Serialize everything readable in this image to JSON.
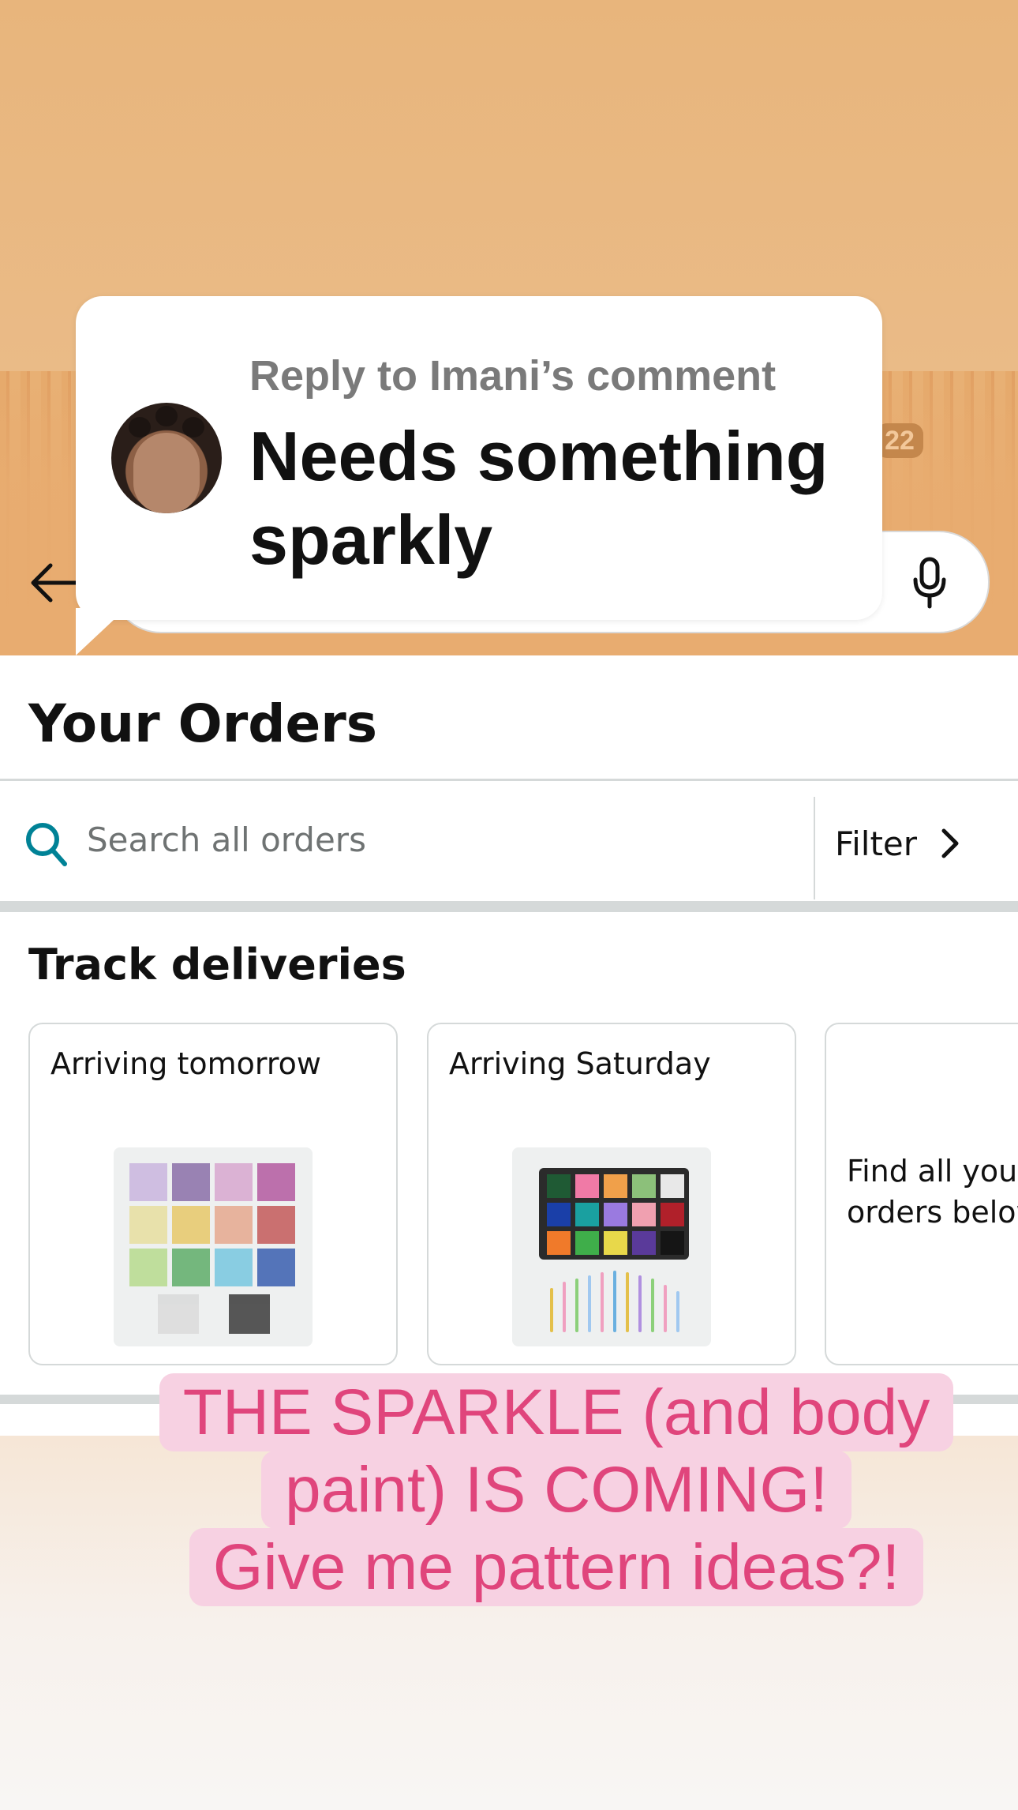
{
  "reply": {
    "label": "Reply to Imani’s comment",
    "text": "Needs something sparkly"
  },
  "header": {
    "cart_count": "22"
  },
  "orders": {
    "title": "Your Orders",
    "search_placeholder": "Search all orders",
    "filter_label": "Filter",
    "track_title": "Track deliveries",
    "cards": [
      {
        "label": "Arriving tomorrow",
        "image": "rhinestone-sticker-sheets"
      },
      {
        "label": "Arriving Saturday",
        "image": "face-paint-palette-with-brushes"
      },
      {
        "label": "Find all your orders below",
        "image": ""
      }
    ]
  },
  "caption": {
    "line1": "THE SPARKLE (and body paint) IS COMING!",
    "line2": "Give me pattern ideas?!"
  },
  "colors": {
    "accent_teal": "#008296",
    "caption_pink": "#e0457c",
    "caption_bg": "#f7d1e2",
    "header_orange": "#e8ac70"
  }
}
